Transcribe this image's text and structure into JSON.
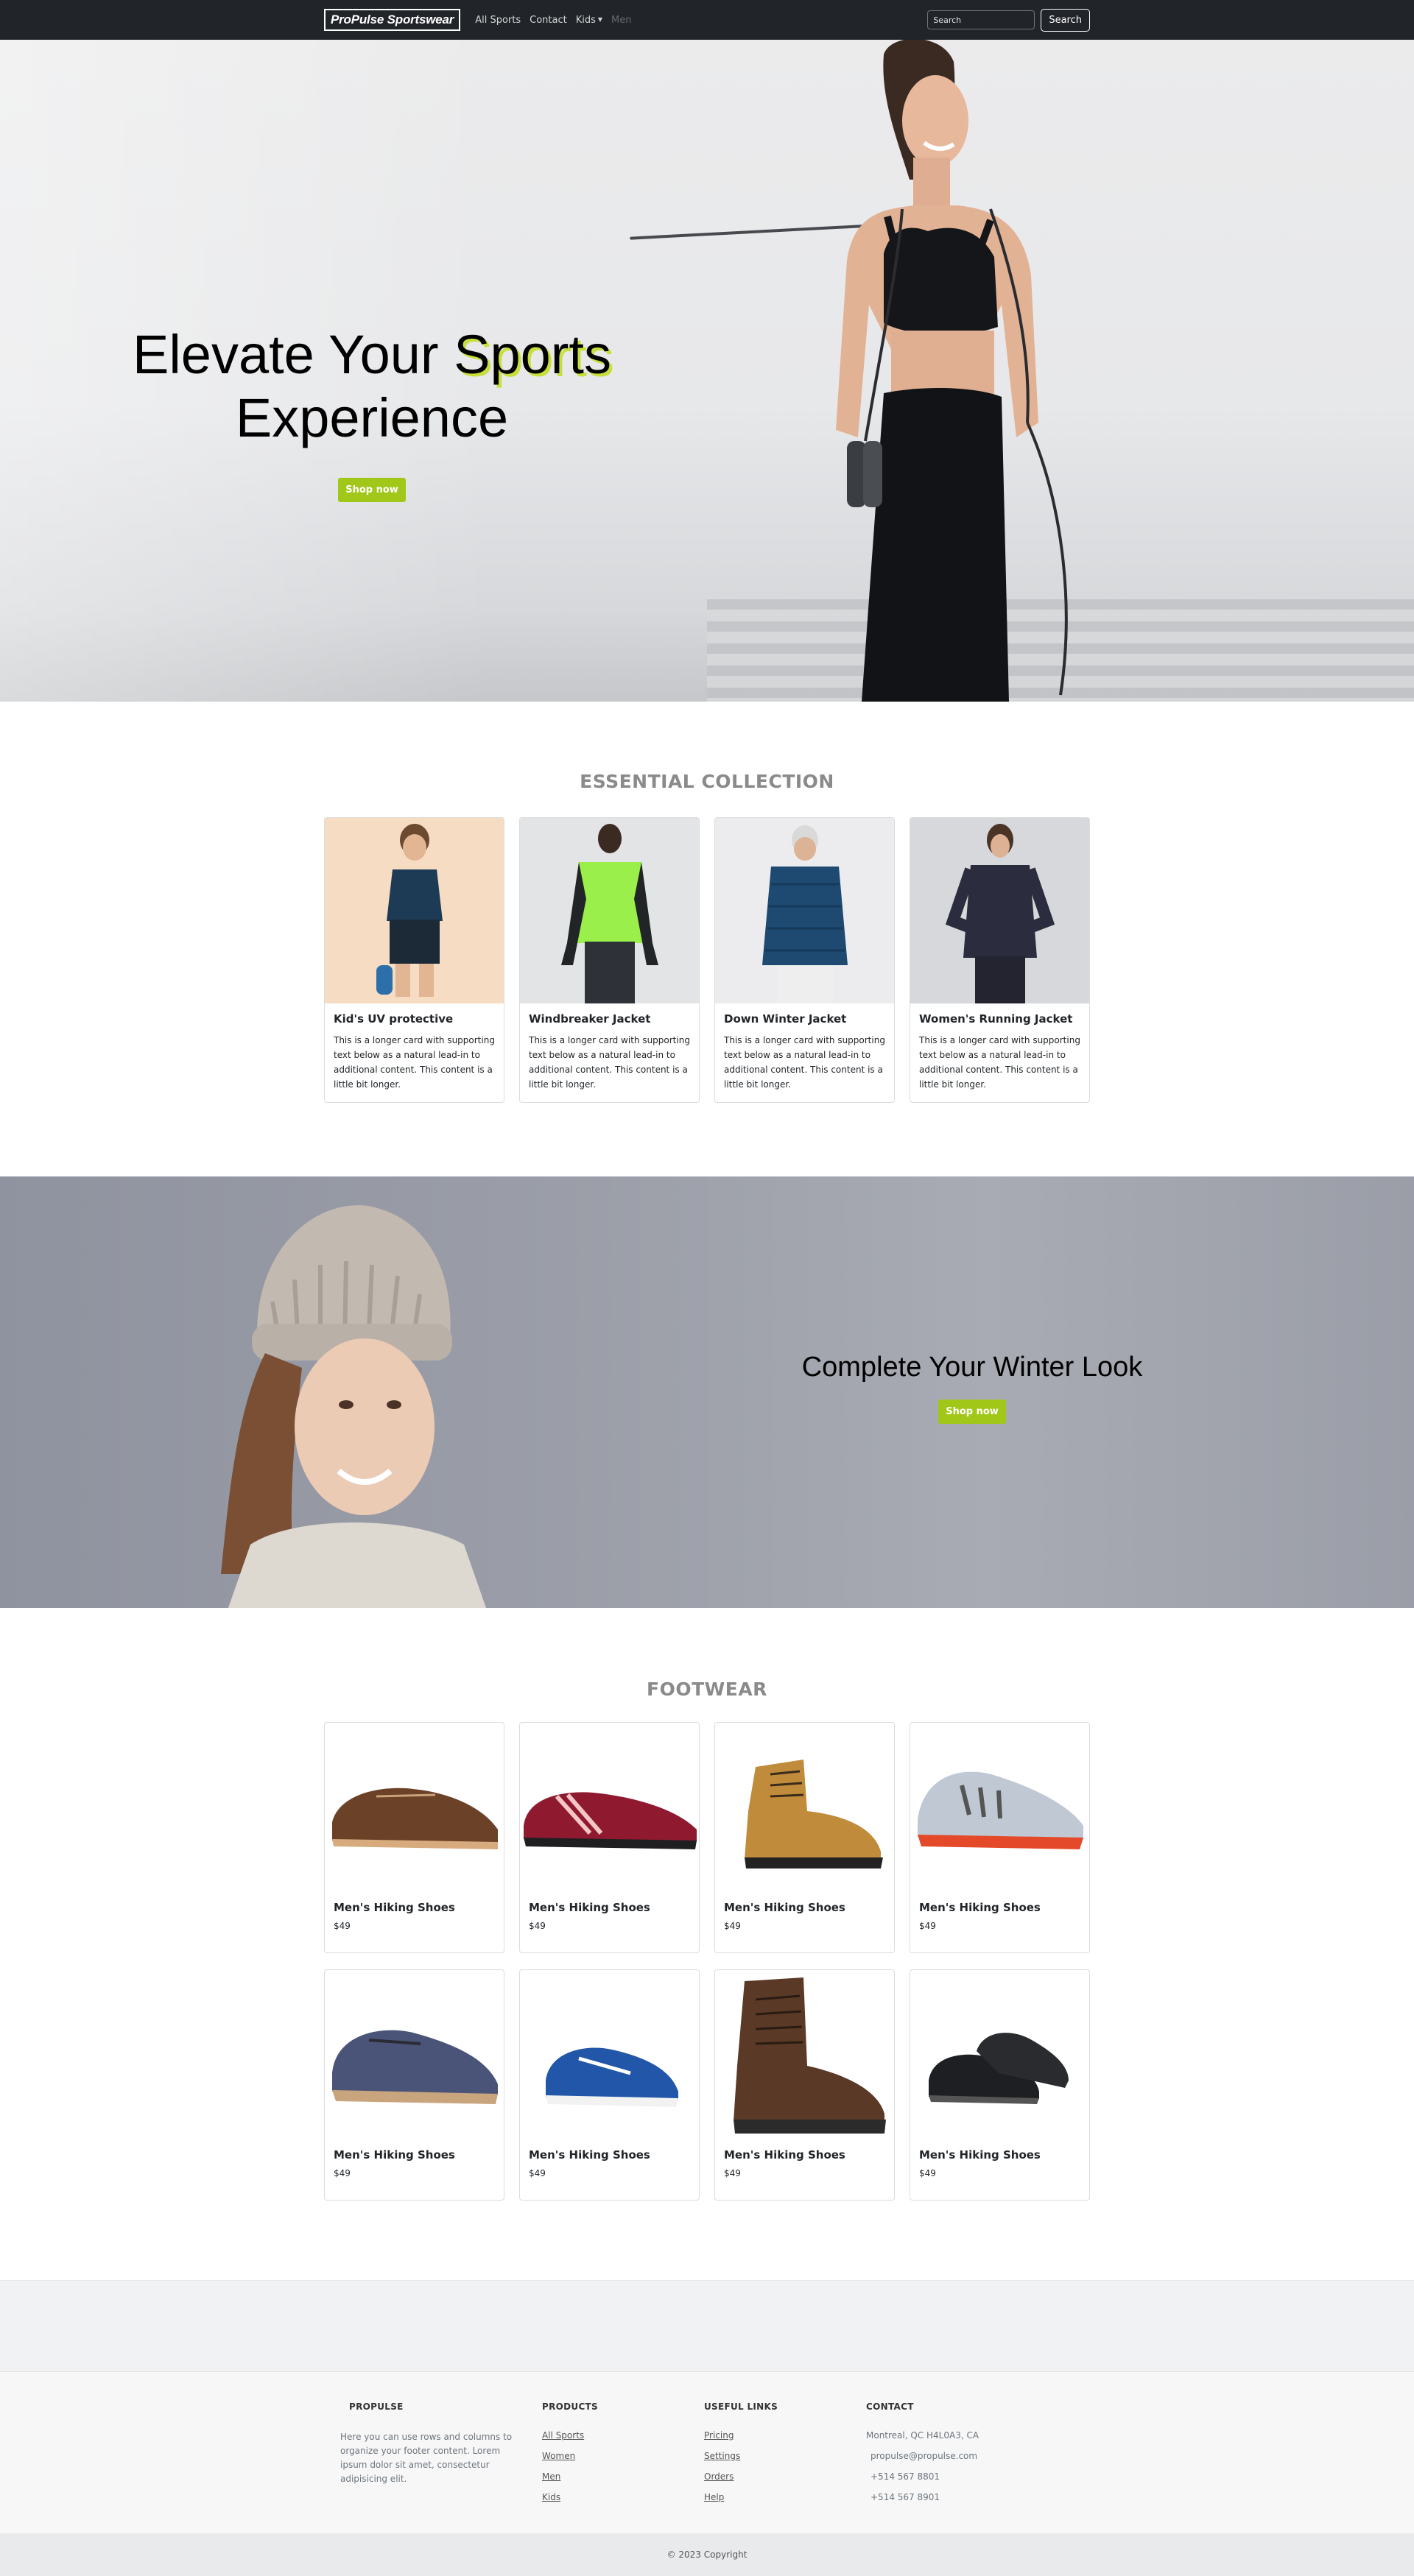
{
  "navbar": {
    "brand": "ProPulse Sportswear",
    "links": [
      "All Sports",
      "Contact",
      "Kids",
      "Men"
    ],
    "search_placeholder": "Search",
    "search_button": "Search"
  },
  "hero": {
    "title_part1": "Elevate Your ",
    "title_accent": "Sports",
    "title_part2": "Experience",
    "button": "Shop now"
  },
  "collection": {
    "title": "ESSENTIAL COLLECTION",
    "cards": [
      {
        "title": "Kid's UV protective",
        "text": "This is a longer card with supporting text below as a natural lead-in to additional content. This content is a little bit longer."
      },
      {
        "title": "Windbreaker Jacket",
        "text": "This is a longer card with supporting text below as a natural lead-in to additional content. This content is a little bit longer."
      },
      {
        "title": "Down Winter Jacket",
        "text": "This is a longer card with supporting text below as a natural lead-in to additional content. This content is a little bit longer."
      },
      {
        "title": "Women's Running Jacket",
        "text": "This is a longer card with supporting text below as a natural lead-in to additional content. This content is a little bit longer."
      }
    ]
  },
  "winter": {
    "title": "Complete Your Winter Look",
    "button": "Shop now"
  },
  "footwear": {
    "title": "FOOTWEAR",
    "items": [
      {
        "name": "Men's Hiking Shoes",
        "price": "$49"
      },
      {
        "name": "Men's Hiking Shoes",
        "price": "$49"
      },
      {
        "name": "Men's Hiking Shoes",
        "price": "$49"
      },
      {
        "name": "Men's Hiking Shoes",
        "price": "$49"
      },
      {
        "name": "Men's Hiking Shoes",
        "price": "$49"
      },
      {
        "name": "Men's Hiking Shoes",
        "price": "$49"
      },
      {
        "name": "Men's Hiking Shoes",
        "price": "$49"
      },
      {
        "name": "Men's Hiking Shoes",
        "price": "$49"
      }
    ]
  },
  "footer": {
    "about_heading": "PROPULSE",
    "about_text": "Here you can use rows and columns to organize your footer content. Lorem ipsum dolor sit amet, consectetur adipisicing elit.",
    "products_heading": "PRODUCTS",
    "products": [
      "All Sports",
      "Women",
      "Men",
      "Kids"
    ],
    "links_heading": "USEFUL LINKS",
    "links": [
      "Pricing",
      "Settings",
      "Orders",
      "Help"
    ],
    "contact_heading": "CONTACT",
    "contact": [
      "Montreal, QC H4L0A3, CA",
      "propulse@propulse.com",
      "+514 567 8801",
      "+514 567 8901"
    ],
    "copyright": "© 2023 Copyright"
  },
  "colors": {
    "accent": "#a1c718",
    "navbar": "#212529"
  }
}
